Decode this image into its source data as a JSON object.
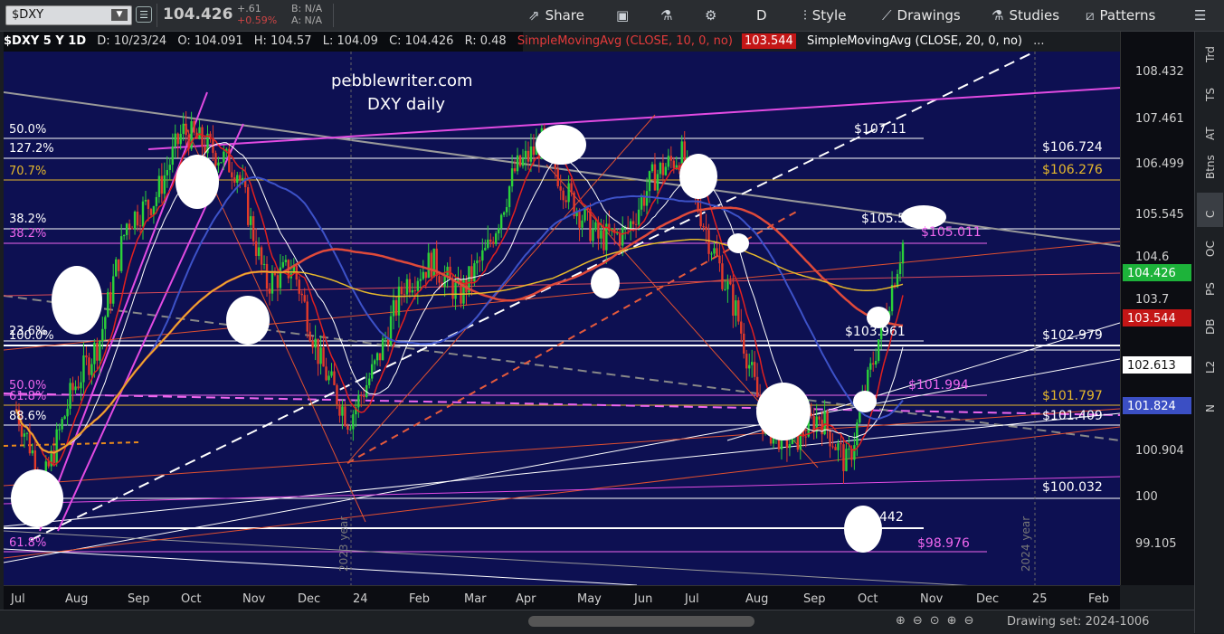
{
  "toolbar": {
    "symbol": "$DXY",
    "last": "104.426",
    "change": "+.61",
    "change_pct": "+0.59%",
    "bid": "B: N/A",
    "ask": "A: N/A",
    "share": "Share",
    "period": "D",
    "style": "Style",
    "drawings": "Drawings",
    "studies": "Studies",
    "patterns": "Patterns"
  },
  "studybar": {
    "title": "$DXY 5 Y 1D",
    "date": "D: 10/23/24",
    "open": "O: 104.091",
    "high": "H: 104.57",
    "low": "L: 104.09",
    "close": "C: 104.426",
    "range": "R: 0.48",
    "sma10": "SimpleMovingAvg (CLOSE, 10, 0, no)",
    "sma10_value": "103.544",
    "sma20": "SimpleMovingAvg (CLOSE, 20, 0, no)",
    "more": "..."
  },
  "right_tabs": [
    "Trd",
    "TS",
    "AT",
    "Btns",
    "C",
    "OC",
    "PS",
    "DB",
    "L2",
    "N"
  ],
  "drawing_set": "Drawing set: 2024-1006",
  "chart_data": {
    "type": "candlestick",
    "watermark": [
      "pebblewriter.com",
      "DXY daily"
    ],
    "y_ticks": [
      "108.432",
      "107.461",
      "106.499",
      "105.545",
      "104.6",
      "103.7",
      "100.904",
      "100",
      "99.105"
    ],
    "x_ticks": [
      "Jul",
      "Aug",
      "Sep",
      "Oct",
      "Nov",
      "Dec",
      "24",
      "Feb",
      "Mar",
      "Apr",
      "May",
      "Jun",
      "Jul",
      "Aug",
      "Sep",
      "Oct",
      "Nov",
      "Dec",
      "25",
      "Feb"
    ],
    "year_labels": [
      "2023 year",
      "2024 year"
    ],
    "price_tags": [
      {
        "label": "104.426",
        "color": "#1db33a"
      },
      {
        "label": "103.544",
        "color": "#c41616"
      },
      {
        "label": "102.613",
        "color": "#ffffff"
      },
      {
        "label": "101.824",
        "color": "#3b4fc4"
      }
    ],
    "fib_labels_left": [
      {
        "label": "50.0%",
        "color": "#ffffff"
      },
      {
        "label": "127.2%",
        "color": "#ffffff"
      },
      {
        "label": "70.7%",
        "color": "#e6b82c"
      },
      {
        "label": "38.2%",
        "color": "#ffffff"
      },
      {
        "label": "38.2%",
        "color": "#ee66ee"
      },
      {
        "label": "23.6%",
        "color": "#ffffff"
      },
      {
        "label": "100.0%",
        "color": "#ffffff"
      },
      {
        "label": "50.0%",
        "color": "#ee66ee"
      },
      {
        "label": "61.8%",
        "color": "#ee66ee"
      },
      {
        "label": "88.6%",
        "color": "#ffffff"
      },
      {
        "label": "61.8%",
        "color": "#ee66ee"
      }
    ],
    "level_labels": [
      {
        "label": "$107.11",
        "color": "#ffffff"
      },
      {
        "label": "$106.724",
        "color": "#ffffff"
      },
      {
        "label": "$106.276",
        "color": "#e6b82c"
      },
      {
        "label": "$105.5",
        "color": "#ffffff"
      },
      {
        "label": "$105.011",
        "color": "#ee66ee"
      },
      {
        "label": "$103.961",
        "color": "#ffffff"
      },
      {
        "label": "$102.979",
        "color": "#ffffff"
      },
      {
        "label": "$101.994",
        "color": "#ee66ee"
      },
      {
        "label": "$101.797",
        "color": "#e6b82c"
      },
      {
        "label": "$101.409",
        "color": "#ffffff"
      },
      {
        "label": "$100.032",
        "color": "#ffffff"
      },
      {
        "label": "442",
        "color": "#ffffff"
      },
      {
        "label": "$98.976",
        "color": "#ee66ee"
      }
    ],
    "price_path": [
      [
        "Jul",
        101.5
      ],
      [
        "Jul",
        100.2
      ],
      [
        "Aug",
        101.8
      ],
      [
        "Aug",
        102.7
      ],
      [
        "Sep",
        104.8
      ],
      [
        "Sep",
        105.2
      ],
      [
        "Oct",
        106.4
      ],
      [
        "Oct",
        106.1
      ],
      [
        "Nov",
        105.7
      ],
      [
        "Nov",
        103.7
      ],
      [
        "Dec",
        104.0
      ],
      [
        "Dec",
        102.3
      ],
      [
        "24",
        101.3
      ],
      [
        "24",
        102.3
      ],
      [
        "Feb",
        103.7
      ],
      [
        "Feb",
        104.1
      ],
      [
        "Mar",
        103.5
      ],
      [
        "Mar",
        104.3
      ],
      [
        "Apr",
        105.7
      ],
      [
        "Apr",
        106.2
      ],
      [
        "May",
        105.2
      ],
      [
        "May",
        104.5
      ],
      [
        "Jun",
        104.6
      ],
      [
        "Jun",
        105.6
      ],
      [
        "Jul",
        106.0
      ],
      [
        "Jul",
        104.5
      ],
      [
        "Aug",
        103.2
      ],
      [
        "Aug",
        101.2
      ],
      [
        "Sep",
        100.9
      ],
      [
        "Sep",
        101.4
      ],
      [
        "Oct",
        100.5
      ],
      [
        "Oct",
        102.5
      ],
      [
        "Oct",
        104.426
      ]
    ]
  }
}
